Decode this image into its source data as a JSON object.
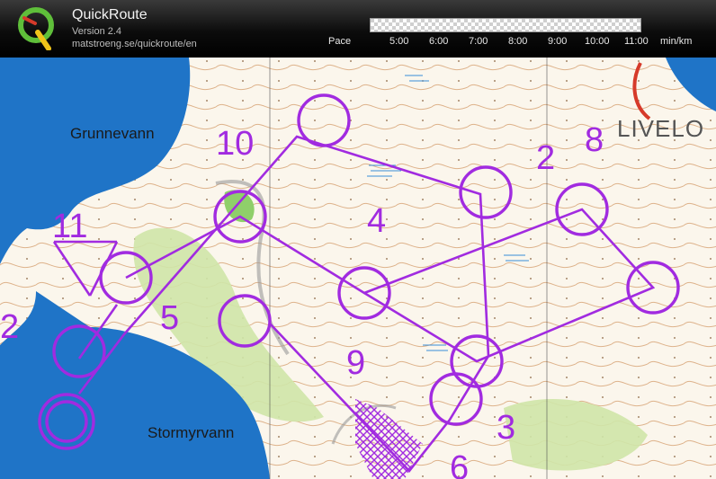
{
  "header": {
    "title": "QuickRoute",
    "version": "Version 2.4",
    "url": "matstroeng.se/quickroute/en",
    "pace_label": "Pace",
    "pace_ticks": [
      "5:00",
      "6:00",
      "7:00",
      "8:00",
      "9:00",
      "10:00",
      "11:00"
    ],
    "pace_unit": "min/km"
  },
  "map": {
    "lake_labels": {
      "north": "Grunnevann",
      "south": "Stormyrvann"
    },
    "sponsor_text": "LIVELO",
    "control_numbers": [
      "2",
      "3",
      "4",
      "5",
      "6",
      "8",
      "9",
      "10",
      "11",
      "2"
    ]
  },
  "colors": {
    "course": "#a12be0",
    "lake": "#1f74c7",
    "contour": "#b06a2a",
    "forest_green": "#c9e3a3"
  }
}
